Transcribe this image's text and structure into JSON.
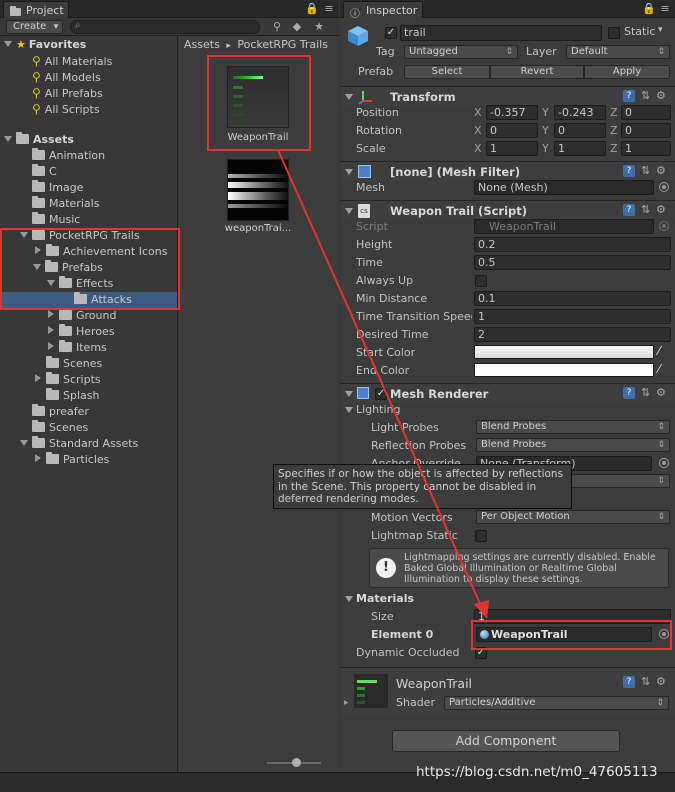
{
  "project": {
    "tab_label": "Project",
    "create_label": "Create",
    "favorites": {
      "title": "Favorites",
      "items": [
        "All Materials",
        "All Models",
        "All Prefabs",
        "All Scripts"
      ]
    },
    "assets_root": "Assets",
    "tree": [
      "Animation",
      "C",
      "Image",
      "Materials",
      "Music",
      "PocketRPG Trails",
      "Achievement Icons",
      "Prefabs",
      "Effects",
      "Attacks",
      "Ground",
      "Heroes",
      "Items",
      "Scenes",
      "Scripts",
      "Splash",
      "preafer",
      "Scenes",
      "Standard Assets",
      "Particles"
    ],
    "breadcrumb": {
      "root": "Assets",
      "sep": "▸",
      "folder": "PocketRPG Trails"
    },
    "asset_items": [
      {
        "name": "WeaponTrail"
      },
      {
        "name": "weaponTrai..."
      }
    ]
  },
  "inspector": {
    "tab_label": "Inspector",
    "object": {
      "name": "trail",
      "static_label": "Static",
      "active": "✓"
    },
    "tag": {
      "label": "Tag",
      "value": "Untagged"
    },
    "layer": {
      "label": "Layer",
      "value": "Default"
    },
    "prefab": {
      "label": "Prefab",
      "select": "Select",
      "revert": "Revert",
      "apply": "Apply"
    },
    "transform": {
      "title": "Transform",
      "position": {
        "label": "Position",
        "x": "-0.357",
        "y": "-0.243",
        "z": "0"
      },
      "rotation": {
        "label": "Rotation",
        "x": "0",
        "y": "0",
        "z": "0"
      },
      "scale": {
        "label": "Scale",
        "x": "1",
        "y": "1",
        "z": "1"
      },
      "axes": {
        "x": "X",
        "y": "Y",
        "z": "Z"
      }
    },
    "mesh_filter": {
      "title": "[none] (Mesh Filter)",
      "mesh_label": "Mesh",
      "mesh_value": "None (Mesh)"
    },
    "weapon_trail": {
      "title": "Weapon Trail (Script)",
      "script_label": "Script",
      "script_value": "WeaponTrail",
      "height_label": "Height",
      "height": "0.2",
      "time_label": "Time",
      "time": "0.5",
      "always_up_label": "Always Up",
      "min_distance_label": "Min Distance",
      "min_distance": "0.1",
      "time_transition_label": "Time Transition Speed",
      "time_transition": "1",
      "desired_time_label": "Desired Time",
      "desired_time": "2",
      "start_color_label": "Start Color",
      "end_color_label": "End Color"
    },
    "mesh_renderer": {
      "title": "Mesh Renderer",
      "lighting_label": "Lighting",
      "light_probes_label": "Light Probes",
      "light_probes": "Blend Probes",
      "reflection_probes_label": "Reflection Probes",
      "reflection_probes": "Blend Probes",
      "anchor_override_label": "Anchor Override",
      "anchor_override": "None (Transform)",
      "motion_vectors_label": "Motion Vectors",
      "motion_vectors": "Per Object Motion",
      "lightmap_static_label": "Lightmap Static",
      "help_text": "Lightmapping settings are currently disabled. Enable Baked Global Illumination or Realtime Global Illumination to display these settings.",
      "materials_label": "Materials",
      "size_label": "Size",
      "size": "1",
      "element0_label": "Element 0",
      "element0": "WeaponTrail",
      "dynamic_occluded_label": "Dynamic Occluded"
    },
    "material": {
      "name": "WeaponTrail",
      "shader_label": "Shader",
      "shader": "Particles/Additive"
    },
    "tooltip": "Specifies if or how the object is affected by reflections in the Scene. This property cannot be disabled in deferred rendering modes.",
    "add_component": "Add Component"
  },
  "watermark": "https://blog.csdn.net/m0_47605113",
  "colors": {
    "annotation_red": "#e53333",
    "selection_blue": "#3d5a80",
    "panel_bg": "#383838"
  }
}
